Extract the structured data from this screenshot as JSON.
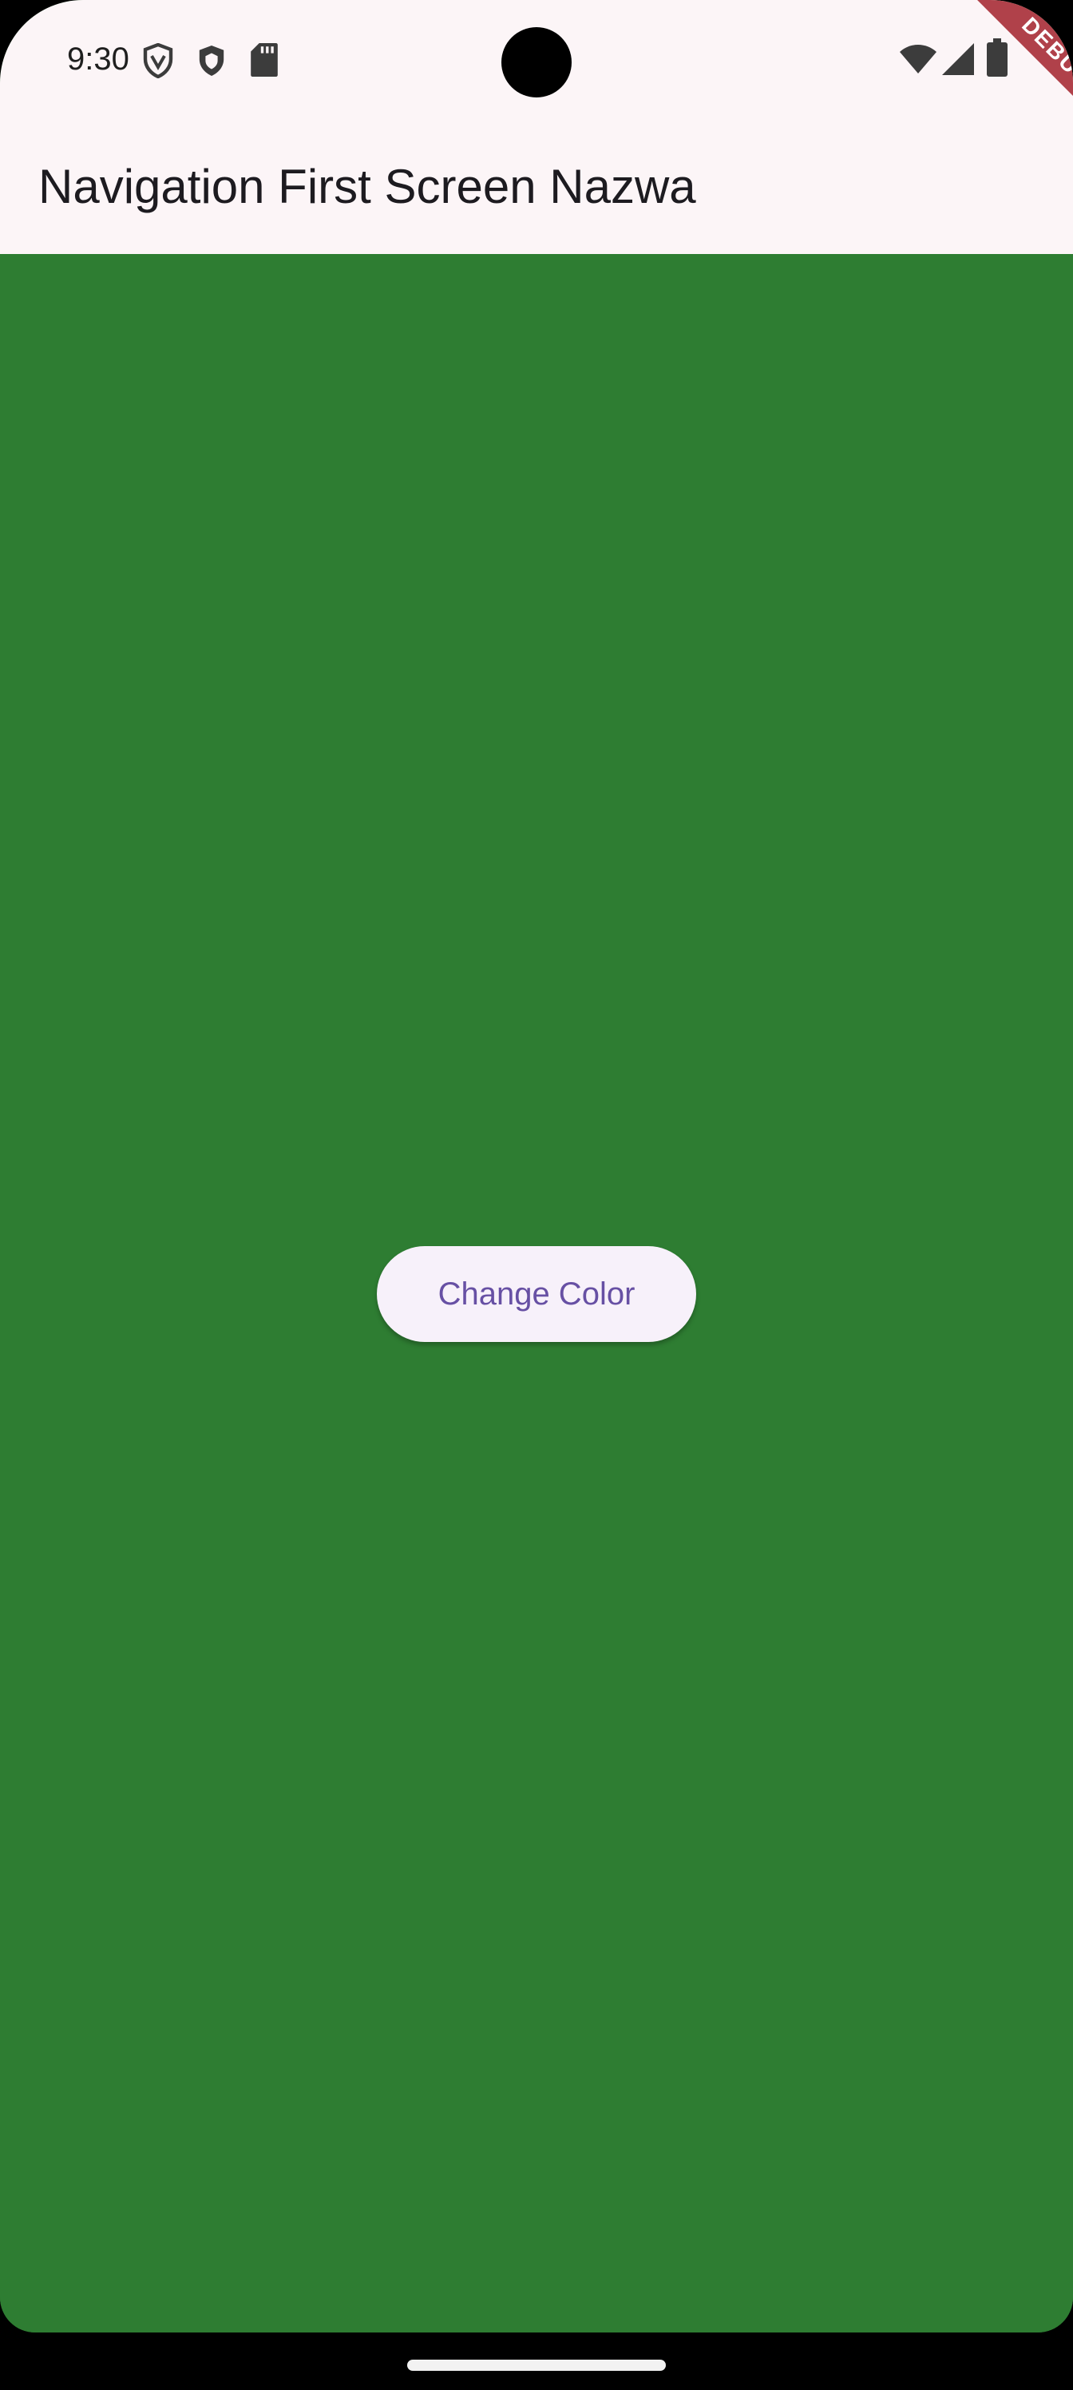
{
  "status_bar": {
    "time": "9:30",
    "left_icons": [
      "vpn-shield-icon",
      "shield-icon",
      "sd-card-icon"
    ],
    "right_icons": [
      "wifi-icon",
      "cell-signal-icon",
      "battery-icon"
    ]
  },
  "app_bar": {
    "title": "Navigation First Screen Nazwa"
  },
  "main": {
    "button_label": "Change Color"
  },
  "debug_banner": {
    "label": "DEBUG"
  },
  "colors": {
    "app_bar_background": "#FCF5F7",
    "body_background": "#2E7D32",
    "button_background": "#F7F1FA",
    "button_text": "#6750A4",
    "debug_ribbon": "#B0414A"
  }
}
